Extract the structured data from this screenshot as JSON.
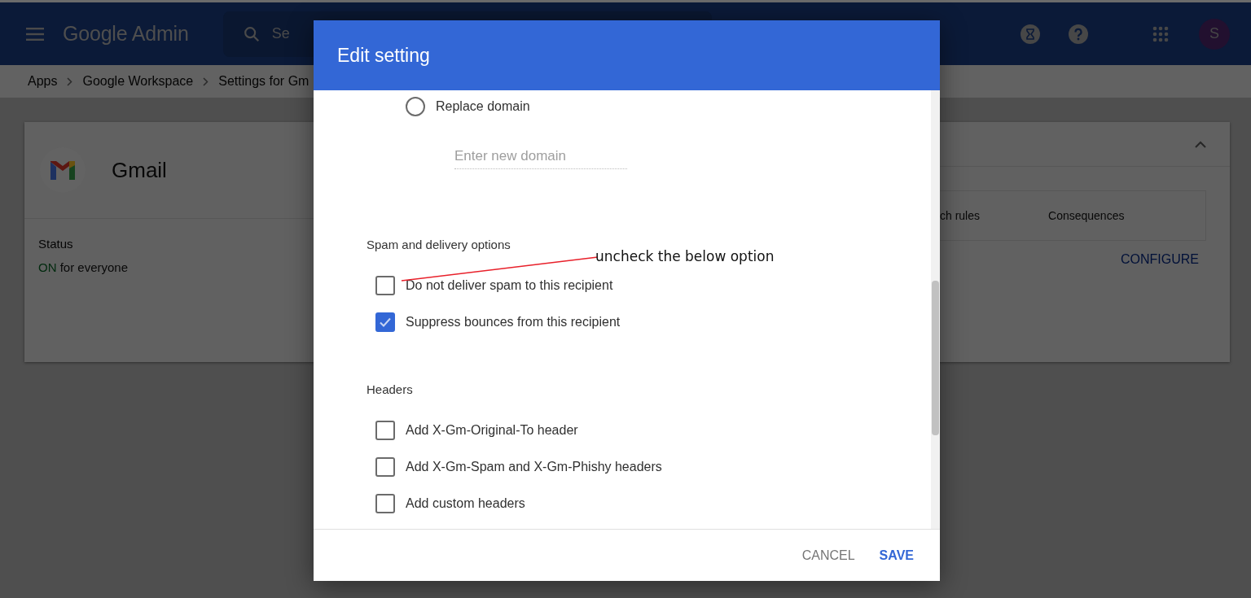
{
  "header": {
    "product": "Google Admin",
    "search_placeholder": "Se",
    "avatar_initial": "S"
  },
  "breadcrumbs": [
    "Apps",
    "Google Workspace",
    "Settings for Gm"
  ],
  "app_card": {
    "name": "Gmail",
    "status_label": "Status",
    "status_value": "ON",
    "status_scope": "for everyone",
    "table_columns": [
      "ch rules",
      "Consequences"
    ],
    "configure": "CONFIGURE"
  },
  "dialog": {
    "title": "Edit setting",
    "radio": {
      "label": "Replace domain",
      "selected": false
    },
    "domain_field": {
      "placeholder": "Enter new domain"
    },
    "sections": [
      {
        "heading": "Spam and delivery options",
        "options": [
          {
            "label": "Do not deliver spam to this recipient",
            "checked": false
          },
          {
            "label": "Suppress bounces from this recipient",
            "checked": true
          }
        ]
      },
      {
        "heading": "Headers",
        "options": [
          {
            "label": "Add X-Gm-Original-To header",
            "checked": false
          },
          {
            "label": "Add X-Gm-Spam and X-Gm-Phishy headers",
            "checked": false
          },
          {
            "label": "Add custom headers",
            "checked": false
          }
        ]
      }
    ],
    "buttons": [
      {
        "label": "CANCEL",
        "kind": "secondary"
      },
      {
        "label": "SAVE",
        "kind": "primary"
      }
    ]
  },
  "annotation": {
    "text": "uncheck the below option"
  }
}
